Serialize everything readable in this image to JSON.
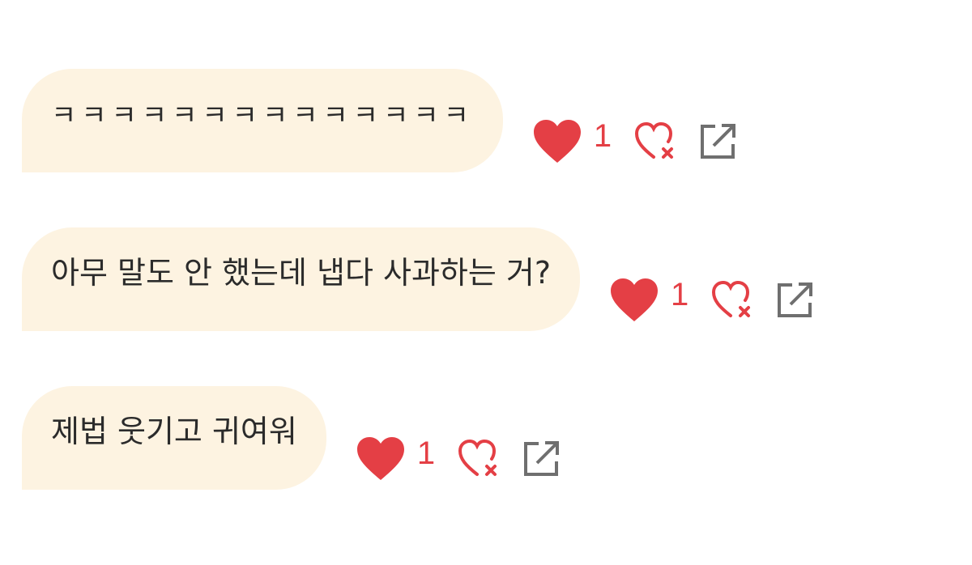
{
  "messages": [
    {
      "text": "ㅋㅋㅋㅋㅋㅋㅋㅋㅋㅋㅋㅋㅋㅋ",
      "likes": "1"
    },
    {
      "text": "아무 말도 안 했는데 냅다 사과하는 거?",
      "likes": "1"
    },
    {
      "text": "제법 웃기고 귀여워",
      "likes": "1"
    }
  ],
  "icons": {
    "like": "heart-icon",
    "unlike": "heart-x-icon",
    "share": "share-external-icon"
  },
  "colors": {
    "bubble_bg": "#fdf3e1",
    "heart": "#e43f45",
    "share": "#6f6f6f",
    "text": "#2b2b2b"
  }
}
